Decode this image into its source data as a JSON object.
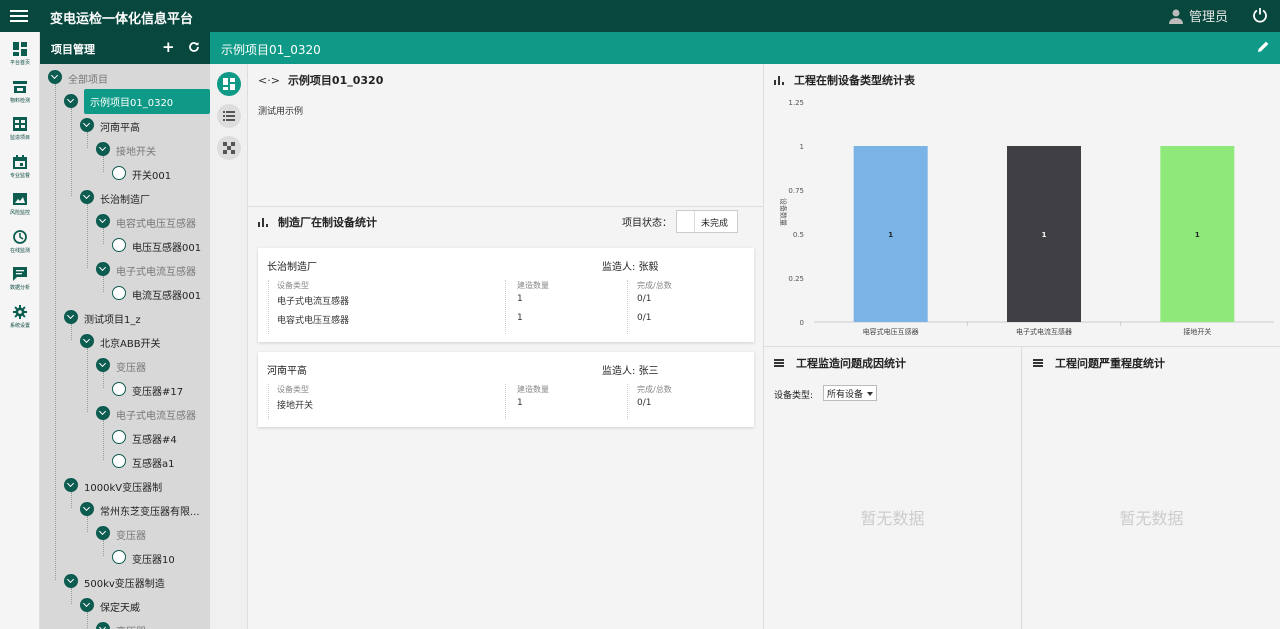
{
  "topbar": {
    "title": "变电运检一体化信息平台",
    "user": "管理员"
  },
  "rail": [
    {
      "label": "平台首页",
      "icon": "dashboard-icon"
    },
    {
      "label": "物料检测",
      "icon": "store-icon"
    },
    {
      "label": "监造项目",
      "icon": "grid-icon"
    },
    {
      "label": "专业监督",
      "icon": "calendar-icon"
    },
    {
      "label": "风险监控",
      "icon": "image-icon"
    },
    {
      "label": "在线监测",
      "icon": "clock-icon"
    },
    {
      "label": "数据分析",
      "icon": "message-icon"
    },
    {
      "label": "系统设置",
      "icon": "gear-icon"
    }
  ],
  "tree": {
    "header": "项目管理",
    "nodes": [
      {
        "label": "全部项目",
        "level": 0,
        "kind": "expand",
        "muted": true
      },
      {
        "label": "示例项目01_0320",
        "level": 1,
        "kind": "expand",
        "selected": true
      },
      {
        "label": "河南平高",
        "level": 2,
        "kind": "expand"
      },
      {
        "label": "接地开关",
        "level": 3,
        "kind": "expand",
        "muted": true
      },
      {
        "label": "开关001",
        "level": 4,
        "kind": "leaf"
      },
      {
        "label": "长治制造厂",
        "level": 2,
        "kind": "expand"
      },
      {
        "label": "电容式电压互感器",
        "level": 3,
        "kind": "expand",
        "muted": true
      },
      {
        "label": "电压互感器001",
        "level": 4,
        "kind": "leaf"
      },
      {
        "label": "电子式电流互感器",
        "level": 3,
        "kind": "expand",
        "muted": true
      },
      {
        "label": "电流互感器001",
        "level": 4,
        "kind": "leaf"
      },
      {
        "label": "测试项目1_z",
        "level": 1,
        "kind": "expand"
      },
      {
        "label": "北京ABB开关",
        "level": 2,
        "kind": "expand"
      },
      {
        "label": "变压器",
        "level": 3,
        "kind": "expand",
        "muted": true
      },
      {
        "label": "变压器#17",
        "level": 4,
        "kind": "leaf"
      },
      {
        "label": "电子式电流互感器",
        "level": 3,
        "kind": "expand",
        "muted": true
      },
      {
        "label": "互感器#4",
        "level": 4,
        "kind": "leaf"
      },
      {
        "label": "互感器a1",
        "level": 4,
        "kind": "leaf"
      },
      {
        "label": "1000kV变压器制",
        "level": 1,
        "kind": "expand"
      },
      {
        "label": "常州东芝变压器有限...",
        "level": 2,
        "kind": "expand"
      },
      {
        "label": "变压器",
        "level": 3,
        "kind": "expand",
        "muted": true
      },
      {
        "label": "变压器10",
        "level": 4,
        "kind": "leaf"
      },
      {
        "label": "500kv变压器制造",
        "level": 1,
        "kind": "expand"
      },
      {
        "label": "保定天威",
        "level": 2,
        "kind": "expand"
      },
      {
        "label": "变压器",
        "level": 3,
        "kind": "expand",
        "muted": true
      }
    ]
  },
  "content": {
    "header": "示例项目01_0320",
    "project_title": "示例项目01_0320",
    "project_desc": "测试用示例",
    "factory_section_title": "制造厂在制设备统计",
    "status_label": "项目状态：",
    "status_value": "未完成",
    "col_type": "设备类型",
    "col_count": "建造数量",
    "col_progress": "完成/总数",
    "supervisor_prefix": "监造人: ",
    "factories": [
      {
        "name": "长治制造厂",
        "supervisor": "张毅",
        "rows": [
          {
            "type": "电子式电流互感器",
            "count": "1",
            "progress": "0/1"
          },
          {
            "type": "电容式电压互感器",
            "count": "1",
            "progress": "0/1"
          }
        ]
      },
      {
        "name": "河南平高",
        "supervisor": "张三",
        "rows": [
          {
            "type": "接地开关",
            "count": "1",
            "progress": "0/1"
          }
        ]
      }
    ]
  },
  "chart_panel": {
    "title": "工程在制设备类型统计表",
    "ylabel": "设备数量"
  },
  "chart_data": {
    "type": "bar",
    "categories": [
      "电容式电压互感器",
      "电子式电流互感器",
      "接地开关"
    ],
    "values": [
      1,
      1,
      1
    ],
    "colors": [
      "#7ab3e6",
      "#404044",
      "#8fe87a"
    ],
    "ylim": [
      0,
      1.25
    ],
    "yticks": [
      "0",
      "0.25",
      "0.5",
      "0.75",
      "1",
      "1.25"
    ],
    "data_labels": [
      "1",
      "1",
      "1"
    ],
    "ylabel": "设备数量",
    "grid": false
  },
  "bottom_left": {
    "title": "工程监造问题成因统计",
    "filter_label": "设备类型:",
    "filter_value": "所有设备",
    "empty": "暂无数据"
  },
  "bottom_right": {
    "title": "工程问题严重程度统计",
    "empty": "暂无数据"
  }
}
